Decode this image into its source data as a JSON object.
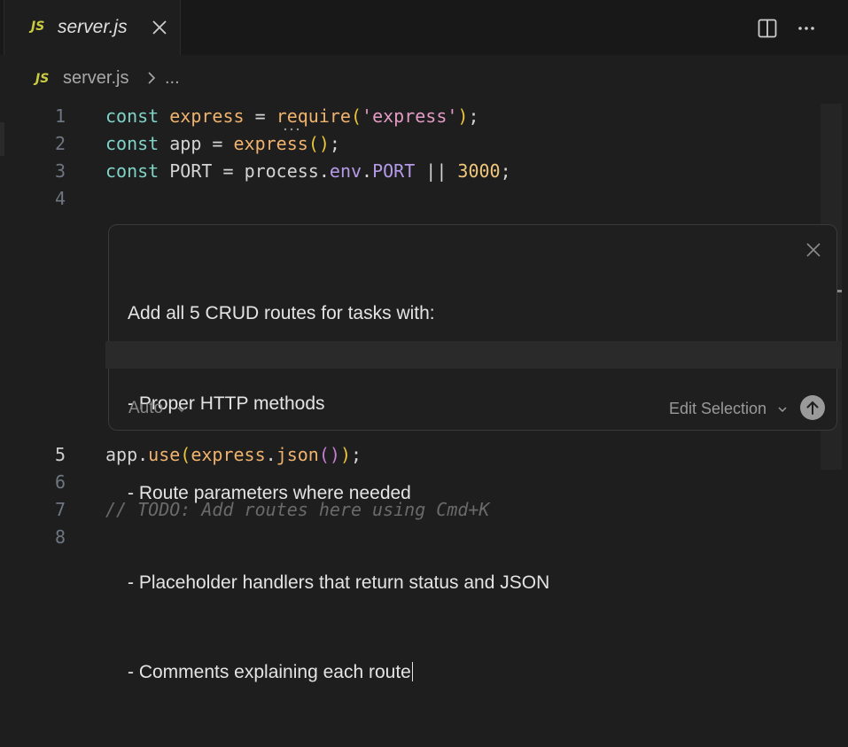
{
  "tab": {
    "lang_badge": "JS",
    "file_name": "server.js"
  },
  "breadcrumb": {
    "lang_badge": "JS",
    "file_name": "server.js",
    "ellipsis": "..."
  },
  "line_numbers": {
    "l1": "1",
    "l2": "2",
    "l3": "3",
    "l4": "4",
    "l5": "5",
    "l6": "6",
    "l7": "7",
    "l8": "8"
  },
  "code": {
    "line1": {
      "kw": "const",
      "name": "express",
      "eq": " = ",
      "fn": "require",
      "open": "(",
      "str": "'express'",
      "close": ")",
      "end": ";"
    },
    "line2": {
      "kw": "const",
      "name": "app",
      "eq": " = ",
      "fn": "express",
      "parens": "()",
      "end": ";"
    },
    "line3": {
      "kw": "const",
      "name": "PORT",
      "eq": " = ",
      "obj": "process",
      "dot1": ".",
      "prop1": "env",
      "dot2": ".",
      "prop2": "PORT",
      "op": " || ",
      "num": "3000",
      "end": ";"
    },
    "line5": {
      "obj": "app",
      "dot1": ".",
      "fn": "use",
      "open": "(",
      "obj2": "express",
      "dot2": ".",
      "fn2": "json",
      "inner": "()",
      "close": ")",
      "end": ";"
    },
    "line7": {
      "comment": "// TODO: Add routes here using Cmd+K"
    }
  },
  "prompt": {
    "lines": [
      "Add all 5 CRUD routes for tasks with:",
      "- Proper HTTP methods",
      "- Route parameters where needed",
      "- Placeholder handlers that return status and JSON",
      "- Comments explaining each route"
    ],
    "mode_label": "Auto",
    "edit_selection_label": "Edit Selection"
  },
  "icons": {
    "tab_close": "close-icon",
    "split_editor": "split-editor-icon",
    "more_actions": "more-actions-icon",
    "breadcrumb_chevron": "chevron-right-icon",
    "prompt_close": "close-icon",
    "send": "arrow-up-icon"
  }
}
